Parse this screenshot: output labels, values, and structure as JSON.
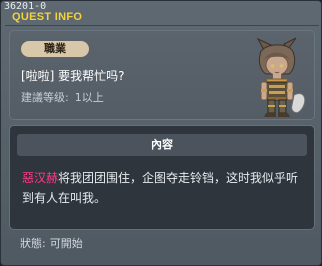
{
  "header": {
    "quest_id": "36201-0",
    "title": "QUEST INFO"
  },
  "info": {
    "job_label": "職業",
    "quest_name": "[啦啦] 要我帮忙吗?",
    "level_label": "建議等级:",
    "level_value": "1以上"
  },
  "content": {
    "header": "內容",
    "npc_name": "惡汉赫",
    "text": "将我团团围住，企图夺走铃铛，这时我似乎听到有人在叫我。"
  },
  "status": {
    "label": "狀態:",
    "value": "可開始"
  },
  "colors": {
    "title_yellow": "#f3d23b",
    "npc_pink": "#ff3b8d",
    "panel_bg": "#2e353c",
    "window_bg": "#5b646d"
  }
}
